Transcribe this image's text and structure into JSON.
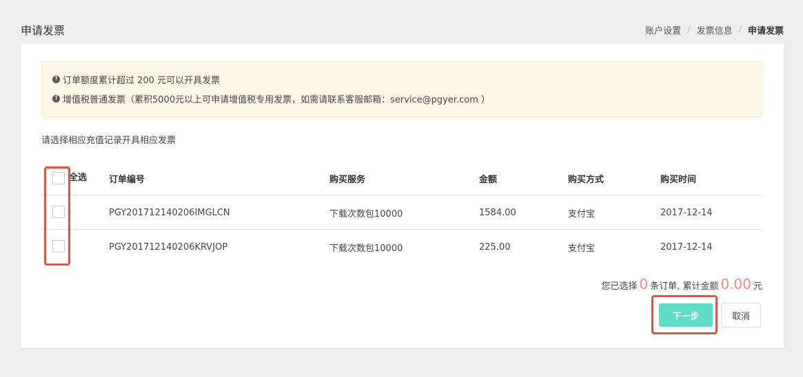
{
  "header": {
    "title": "申请发票",
    "breadcrumb": [
      "账户设置",
      "发票信息",
      "申请发票"
    ],
    "separator": "/"
  },
  "notice": {
    "icon": "info-circle-icon",
    "lines": [
      "订单额度累计超过 200 元可以开具发票",
      "增值税普通发票（累积5000元以上可申请增值税专用发票，如需请联系客服邮箱：service@pgyer.com ）"
    ]
  },
  "instruction": "请选择相应充值记录开具相应发票",
  "table": {
    "select_all_label": "全选",
    "columns": [
      "订单编号",
      "购买服务",
      "金额",
      "购买方式",
      "购买时间"
    ],
    "rows": [
      [
        "PGY201712140206IMGLCN",
        "下载次数包10000",
        "1584.00",
        "支付宝",
        "2017-12-14"
      ],
      [
        "PGY201712140206KRVJOP",
        "下载次数包10000",
        "225.00",
        "支付宝",
        "2017-12-14"
      ]
    ]
  },
  "summary": {
    "prefix": "您已选择",
    "count": "0",
    "middle": "条订单, 累计金额",
    "amount": "0.00",
    "suffix": "元"
  },
  "actions": {
    "next_label": "下一步",
    "cancel_label": "取消"
  },
  "colors": {
    "accent": "#5fdcc4",
    "highlight_red": "#e8503a",
    "summary_number": "#f38a8a",
    "notice_bg": "#fdf8e6"
  }
}
